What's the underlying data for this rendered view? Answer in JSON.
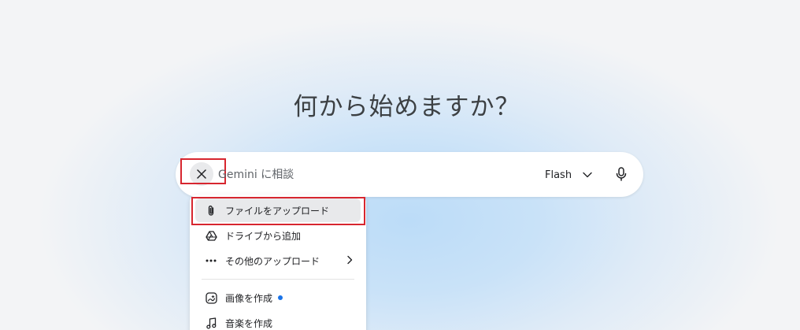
{
  "headline": "何から始めますか？",
  "prompt": {
    "placeholder": "Gemini に相談",
    "value": "",
    "model_label": "Flash"
  },
  "menu": {
    "items": [
      {
        "label": "ファイルをアップロード",
        "icon": "paperclip-icon"
      },
      {
        "label": "ドライブから追加",
        "icon": "google-drive-icon"
      },
      {
        "label": "その他のアップロード",
        "icon": "more-horizontal-icon"
      },
      {
        "label": "画像を作成",
        "icon": "image-create-icon"
      },
      {
        "label": "音楽を作成",
        "icon": "music-note-icon"
      }
    ]
  },
  "colors": {
    "highlight": "#d7262f",
    "new_dot": "#1a73e8"
  }
}
